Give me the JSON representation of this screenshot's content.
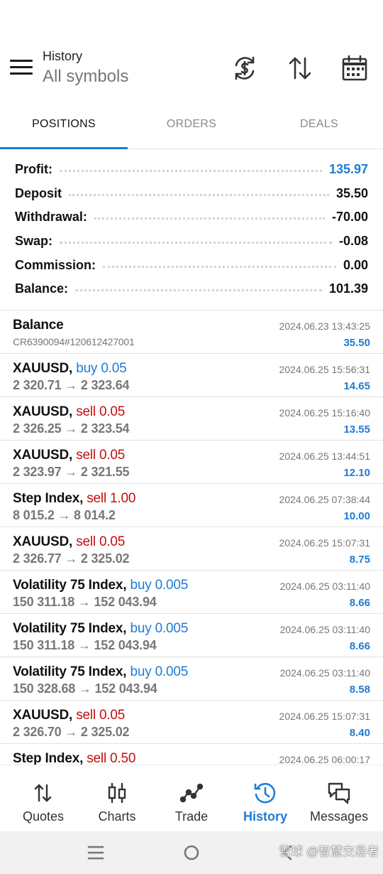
{
  "header": {
    "title": "History",
    "subtitle": "All symbols",
    "icons": [
      "currency-exchange-icon",
      "sort-icon",
      "calendar-icon"
    ]
  },
  "tabs": [
    {
      "label": "POSITIONS",
      "active": true
    },
    {
      "label": "ORDERS",
      "active": false
    },
    {
      "label": "DEALS",
      "active": false
    }
  ],
  "summary": [
    {
      "label": "Profit:",
      "value": "135.97"
    },
    {
      "label": "Deposit",
      "value": "35.50"
    },
    {
      "label": "Withdrawal:",
      "value": "-70.00"
    },
    {
      "label": "Swap:",
      "value": "-0.08"
    },
    {
      "label": "Commission:",
      "value": "0.00"
    },
    {
      "label": "Balance:",
      "value": "101.39"
    }
  ],
  "deals": [
    {
      "symbol": "Balance",
      "type": "",
      "side": "plain",
      "prices": "CR6390094#120612427001",
      "time": "2024.06.23 13:43:25",
      "profit": "35.50"
    },
    {
      "symbol": "XAUUSD,",
      "type": "buy 0.05",
      "side": "buy",
      "prices": "2 320.71 → 2 323.64",
      "time": "2024.06.25 15:56:31",
      "profit": "14.65"
    },
    {
      "symbol": "XAUUSD,",
      "type": "sell 0.05",
      "side": "sell",
      "prices": "2 326.25 → 2 323.54",
      "time": "2024.06.25 15:16:40",
      "profit": "13.55"
    },
    {
      "symbol": "XAUUSD,",
      "type": "sell 0.05",
      "side": "sell",
      "prices": "2 323.97 → 2 321.55",
      "time": "2024.06.25 13:44:51",
      "profit": "12.10"
    },
    {
      "symbol": "Step Index,",
      "type": "sell 1.00",
      "side": "sell",
      "prices": "8 015.2 → 8 014.2",
      "time": "2024.06.25 07:38:44",
      "profit": "10.00"
    },
    {
      "symbol": "XAUUSD,",
      "type": "sell 0.05",
      "side": "sell",
      "prices": "2 326.77 → 2 325.02",
      "time": "2024.06.25 15:07:31",
      "profit": "8.75"
    },
    {
      "symbol": "Volatility 75 Index,",
      "type": "buy 0.005",
      "side": "buy",
      "prices": "150 311.18 → 152 043.94",
      "time": "2024.06.25 03:11:40",
      "profit": "8.66"
    },
    {
      "symbol": "Volatility 75 Index,",
      "type": "buy 0.005",
      "side": "buy",
      "prices": "150 311.18 → 152 043.94",
      "time": "2024.06.25 03:11:40",
      "profit": "8.66"
    },
    {
      "symbol": "Volatility 75 Index,",
      "type": "buy 0.005",
      "side": "buy",
      "prices": "150 328.68 → 152 043.94",
      "time": "2024.06.25 03:11:40",
      "profit": "8.58"
    },
    {
      "symbol": "XAUUSD,",
      "type": "sell 0.05",
      "side": "sell",
      "prices": "2 326.70 → 2 325.02",
      "time": "2024.06.25 15:07:31",
      "profit": "8.40"
    },
    {
      "symbol": "Step Index,",
      "type": "sell 0.50",
      "side": "sell",
      "prices": "",
      "time": "2024.06.25 06:00:17",
      "profit": ""
    }
  ],
  "bottom_nav": [
    {
      "label": "Quotes",
      "icon": "quotes-icon",
      "active": false
    },
    {
      "label": "Charts",
      "icon": "candlestick-icon",
      "active": false
    },
    {
      "label": "Trade",
      "icon": "trade-chart-icon",
      "active": false
    },
    {
      "label": "History",
      "icon": "history-icon",
      "active": true
    },
    {
      "label": "Messages",
      "icon": "messages-icon",
      "active": false
    }
  ],
  "watermark": "雪球 @智慧交易者",
  "colors": {
    "accent": "#1e7bd6",
    "sell": "#c40e0e",
    "muted": "#777777"
  }
}
